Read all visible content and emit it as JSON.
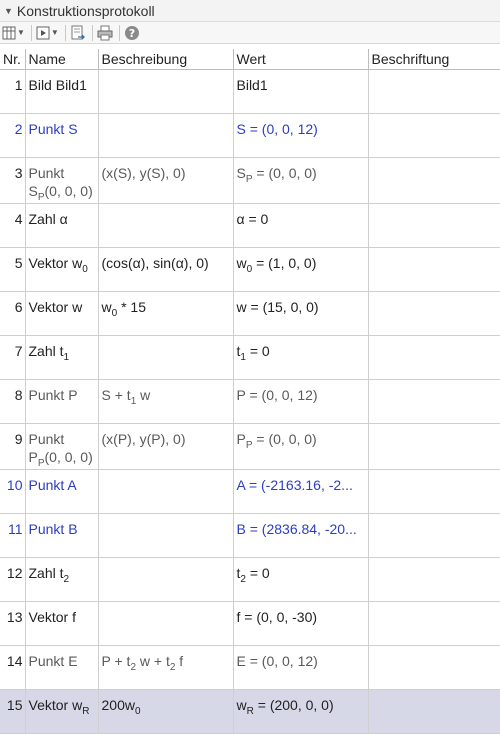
{
  "panel": {
    "title": "Konstruktionsprotokoll"
  },
  "toolbar": {
    "icons": [
      "columns-icon",
      "navigation-icon",
      "export-icon",
      "print-icon",
      "help-icon"
    ]
  },
  "table": {
    "headers": {
      "nr": "Nr.",
      "name": "Name",
      "desc": "Beschreibung",
      "value": "Wert",
      "caption": "Beschriftung"
    },
    "rows": [
      {
        "nr": "1",
        "name": "Bild Bild1",
        "desc": "",
        "value": "Bild1"
      },
      {
        "nr": "2",
        "name": "Punkt S",
        "desc": "",
        "value": "S = (0, 0, 12)"
      },
      {
        "nr": "3",
        "name_a": "Punkt",
        "name_b": "S",
        "name_sub": "P",
        "name_c": "(0, 0, 0)",
        "desc": "(x(S), y(S), 0)",
        "value_a": "S",
        "value_sub": "P",
        "value_b": " = (0, 0, 0)"
      },
      {
        "nr": "4",
        "name": "Zahl α",
        "desc": "",
        "value": "α = 0"
      },
      {
        "nr": "5",
        "name_a": "Vektor w",
        "name_sub": "0",
        "desc": "(cos(α), sin(α), 0)",
        "value_a": "w",
        "value_sub": "0",
        "value_b": " = (1, 0, 0)"
      },
      {
        "nr": "6",
        "name": "Vektor w",
        "desc_a": "w",
        "desc_sub": "0",
        "desc_b": " * 15",
        "value": "w = (15, 0, 0)"
      },
      {
        "nr": "7",
        "name_a": "Zahl t",
        "name_sub": "1",
        "desc": "",
        "value_a": "t",
        "value_sub": "1",
        "value_b": " = 0"
      },
      {
        "nr": "8",
        "name": "Punkt P",
        "desc_a": "S + t",
        "desc_sub": "1",
        "desc_b": " w",
        "value": "P = (0, 0, 12)"
      },
      {
        "nr": "9",
        "name_a": "Punkt",
        "name_b": "P",
        "name_sub": "P",
        "name_c": "(0, 0, 0)",
        "desc": "(x(P), y(P), 0)",
        "value_a": "P",
        "value_sub": "P",
        "value_b": " = (0, 0, 0)"
      },
      {
        "nr": "10",
        "name": "Punkt A",
        "desc": "",
        "value": "A = (-2163.16, -2..."
      },
      {
        "nr": "11",
        "name": "Punkt B",
        "desc": "",
        "value": "B = (2836.84, -20..."
      },
      {
        "nr": "12",
        "name_a": "Zahl t",
        "name_sub": "2",
        "desc": "",
        "value_a": "t",
        "value_sub": "2",
        "value_b": " = 0"
      },
      {
        "nr": "13",
        "name": "Vektor f",
        "desc": "",
        "value": "f = (0, 0, -30)"
      },
      {
        "nr": "14",
        "name": "Punkt E",
        "desc_a": "P + t",
        "desc_sub1": "2",
        "desc_b": " w + t",
        "desc_sub2": "2",
        "desc_c": " f",
        "value": "E = (0, 0, 12)"
      },
      {
        "nr": "15",
        "name_a": "Vektor w",
        "name_sub": "R",
        "desc_a": "200w",
        "desc_sub": "0",
        "value_a": "w",
        "value_sub": "R",
        "value_b": " = (200, 0, 0)"
      }
    ]
  },
  "colors": {
    "blue_text": "#2b3ec3",
    "selected_row": "#d6d8e8",
    "grey_text": "#5a5a5a"
  }
}
